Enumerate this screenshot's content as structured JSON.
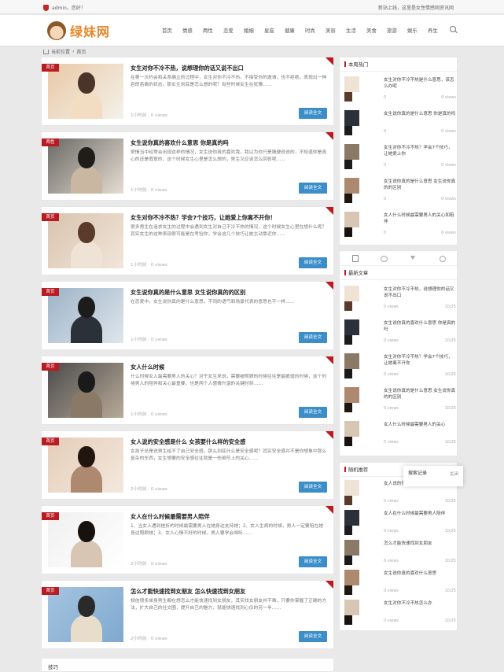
{
  "topbar": {
    "login": "admin，您好！",
    "notice": "新站上线，这里是女性情感网资讯网"
  },
  "header": {
    "logo_text": "绿妹网",
    "nav": [
      "首页",
      "情感",
      "两性",
      "恋爱",
      "婚姻",
      "星座",
      "健康",
      "时尚",
      "美容",
      "生活",
      "美食",
      "旅游",
      "娱乐",
      "养生"
    ]
  },
  "breadcrumb": {
    "home": "当前位置",
    "current": "首页"
  },
  "posts": [
    {
      "tag": "首页",
      "title": "女生对你不冷不热，说想理你的话又说不出口",
      "excerpt": "在第一次约会和关系确立的过程中，女生对你不冷不热，不接受你的邀请，也不拒绝，表现出一种若即若离的状态，那女生到底是怎么想的呢？有些时候女生在犹豫……",
      "date": "1小时前",
      "views": "0 views",
      "more": "阅读全文"
    },
    {
      "tag": "两性",
      "title": "女生说你真的喜欢什么意思 你是真的吗",
      "excerpt": "爱情当中经常会出现这样的情况，女生说你真的喜欢我，我以为你只是随便说说的，不知道你是真心的还是假意的，这个时候女生心里是怎么想的，男生又应该怎么回答呢……",
      "date": "1小时前",
      "views": "0 views",
      "more": "阅读全文"
    },
    {
      "tag": "首页",
      "title": "女生对你不冷不热？学会7个技巧，让她爱上你离不开你！",
      "excerpt": "很多男生在追求女生的过程中会遇到女生对自己不冷不热的情况，这个时候女生心里在想什么呢？其实女生的这种表现很可能是在考验你，学会这几个技巧让她主动靠近你……",
      "date": "1小时前",
      "views": "0 views",
      "more": "阅读全文"
    },
    {
      "tag": "首页",
      "title": "女生说你真的是什么意思 女生说你真的的区别",
      "excerpt": "在恋爱中，女生说你真的是什么意思，不同的语气和场景代表的意思也不一样……",
      "date": "1小时前",
      "views": "0 views",
      "more": "阅读全文"
    },
    {
      "tag": "首页",
      "title": "女人什么时候",
      "excerpt": "什么时候女人最需要男人的关心？对于女生来说，需要被照顾的时候往往是最脆弱的时候，这个时候男人的陪伴和关心最重要，也是两个人感情升温的关键时刻……",
      "date": "1小时前",
      "views": "0 views",
      "more": "阅读全文"
    },
    {
      "tag": "首页",
      "title": "女人说的安全感是什么 女孩要什么样的安全感",
      "excerpt": "女孩子总是说男生给不了自己安全感，那么到底什么是安全感呢？其实安全感并不是你想象中那么复杂的东西，女生想要的安全感往往就是一些细节上的关心……",
      "date": "2小时前",
      "views": "0 views",
      "more": "阅读全文"
    },
    {
      "tag": "首页",
      "title": "女人在什么时候最需要男人陪伴",
      "excerpt": "1、当女人遇到挫折的时候最需要男人在她身边支持她；2、女人生病的时候，男人一定要陪在她身边照顾她；3、女人心情不好的时候，男人要学会倾听……",
      "date": "2小时前",
      "views": "0 views",
      "more": "阅读全文"
    },
    {
      "tag": "首页",
      "title": "怎么才能快速找到女朋友 怎么快速找到女朋友",
      "excerpt": "相信很多单身男生都在想怎么才能快速找到女朋友，其实找女朋友并不难，只要你掌握了正确的方法，扩大自己的社交圈，提升自己的魅力，就能快速找到心仪的另一半……",
      "date": "2小时前",
      "views": "0 views",
      "more": "阅读全文"
    }
  ],
  "sidebar": {
    "hot_title": "本周热门",
    "hot": [
      {
        "title": "女生对你不冷不热是什么意思，该怎么办呢",
        "comments": "0",
        "views": "0 views"
      },
      {
        "title": "女生说你真的是什么意思 你是真的吗",
        "comments": "0",
        "views": "0 views"
      },
      {
        "title": "女生对你不冷不热？学会7个技巧，让她爱上你",
        "comments": "0",
        "views": "0 views"
      },
      {
        "title": "女生说你真的是什么意思 女生说你真的的区别",
        "comments": "0",
        "views": "0 views"
      },
      {
        "title": "女人什么时候最需要男人的关心和陪伴",
        "comments": "0",
        "views": "0 views"
      }
    ],
    "recent_title": "最新文章",
    "recent": [
      {
        "title": "女生对你不冷不热，说想理你的话又说不出口",
        "views": "0 views",
        "date": "10/25"
      },
      {
        "title": "女生说你真的喜欢什么意思 你是真的吗",
        "views": "0 views",
        "date": "10/25"
      },
      {
        "title": "女生对你不冷不热？学会7个技巧，让她离不开你",
        "views": "0 views",
        "date": "10/25"
      },
      {
        "title": "女生说你真的是什么意思 女生说你真的的区别",
        "views": "0 views",
        "date": "10/25"
      },
      {
        "title": "女人什么时候最需要男人的关心",
        "views": "0 views",
        "date": "10/25"
      }
    ],
    "random_title": "随机推荐",
    "random": [
      {
        "title": "女人说的安全感是什么 女孩要什么",
        "views": "0 views",
        "date": "10/25"
      },
      {
        "title": "女人在什么时候最需要男人陪伴",
        "views": "0 views",
        "date": "10/25"
      },
      {
        "title": "怎么才能快速找到女朋友",
        "views": "0 views",
        "date": "10/25"
      },
      {
        "title": "女生说你真的喜欢什么意思",
        "views": "0 views",
        "date": "10/25"
      },
      {
        "title": "女生对你不冷不热怎么办",
        "views": "0 views",
        "date": "10/25"
      }
    ]
  },
  "popup": {
    "text": "搜索记录",
    "button": "关闭"
  },
  "footer": {
    "label": "技巧"
  }
}
